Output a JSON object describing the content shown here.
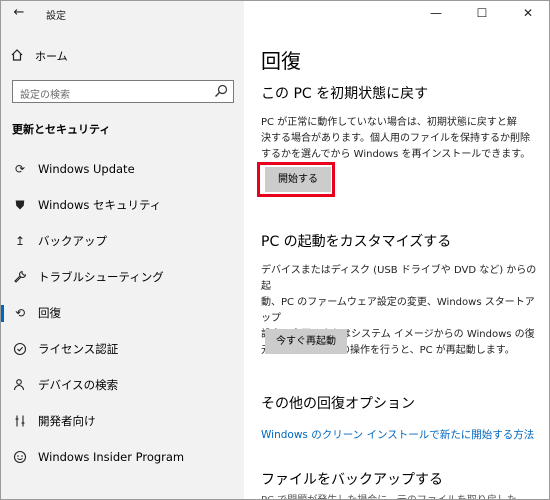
{
  "window": {
    "title": "設定",
    "back_glyph": "←"
  },
  "window_controls": {
    "minimize": "—",
    "maximize": "☐",
    "close": "✕"
  },
  "sidebar": {
    "home_label": "ホーム",
    "search_placeholder": "設定の検索",
    "section_heading": "更新とセキュリティ",
    "items": [
      {
        "label": "Windows Update",
        "icon": "sync-icon",
        "glyph": "⟳"
      },
      {
        "label": "Windows セキュリティ",
        "icon": "shield-icon",
        "glyph": "⛊"
      },
      {
        "label": "バックアップ",
        "icon": "backup-arrow-icon",
        "glyph": "↥"
      },
      {
        "label": "トラブルシューティング",
        "icon": "wrench-icon",
        "glyph": "🔧"
      },
      {
        "label": "回復",
        "icon": "recovery-icon",
        "glyph": "⟲",
        "active": true
      },
      {
        "label": "ライセンス認証",
        "icon": "check-circle-icon",
        "glyph": "✓"
      },
      {
        "label": "デバイスの検索",
        "icon": "person-location-icon",
        "glyph": "⚲"
      },
      {
        "label": "開発者向け",
        "icon": "developer-tools-icon",
        "glyph": "⚙"
      },
      {
        "label": "Windows Insider Program",
        "icon": "insider-icon",
        "glyph": "☺"
      }
    ]
  },
  "main": {
    "title": "回復",
    "reset": {
      "heading": "この PC を初期状態に戻す",
      "lines": [
        "PC が正常に動作していない場合は、初期状態に戻すと解",
        "決する場合があります。個人用のファイルを保持するか削除",
        "するかを選んでから Windows を再インストールできます。"
      ],
      "button": "開始する"
    },
    "advanced": {
      "heading": "PC の起動をカスタマイズする",
      "lines": [
        "デバイスまたはディスク (USB ドライブや DVD など) からの起",
        "動、PC のファームウェア設定の変更、Windows スタートアップ",
        "設定の変更、またはシステム イメージからの Windows の復",
        "元を行います。この操作を行うと、PC が再起動します。"
      ],
      "button": "今すぐ再起動"
    },
    "more": {
      "heading": "その他の回復オプション",
      "link": "Windows のクリーン インストールで新たに開始する方法"
    },
    "backup": {
      "heading": "ファイルをバックアップする",
      "cut_line": "PC で問題が発生した場合に、元のファイルを取り戻した"
    }
  },
  "colors": {
    "accent": "#0067c0",
    "highlight": "#e8001c",
    "sidebar_bg": "#f2f2f2"
  }
}
